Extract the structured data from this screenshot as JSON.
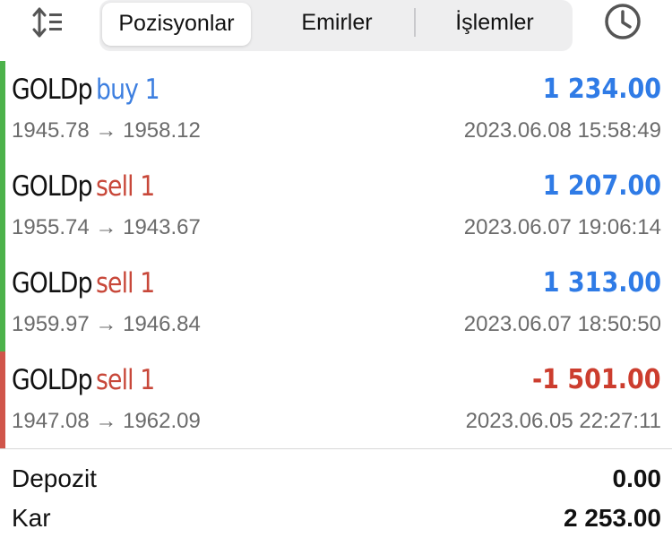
{
  "toolbar": {
    "sort_icon": "sort-icon",
    "history_icon": "clock-icon",
    "tabs": [
      {
        "label": "Pozisyonlar",
        "active": true
      },
      {
        "label": "Emirler",
        "active": false
      },
      {
        "label": "İşlemler",
        "active": false
      }
    ]
  },
  "colors": {
    "buy": "#3d7fe0",
    "sell": "#c8483a",
    "profit_positive": "#2f7be6",
    "profit_negative": "#cc3d2e",
    "bar_green": "#4cb24a",
    "bar_red": "#d0554a"
  },
  "positions": [
    {
      "symbol": "GOLDp",
      "side": "buy 1",
      "type": "buy",
      "profit": "1 234.00",
      "profit_sign": "positive",
      "prices": "1945.78 → 1958.12",
      "time": "2023.06.08 15:58:49"
    },
    {
      "symbol": "GOLDp",
      "side": "sell 1",
      "type": "sell",
      "profit": "1 207.00",
      "profit_sign": "positive",
      "prices": "1955.74 → 1943.67",
      "time": "2023.06.07 19:06:14"
    },
    {
      "symbol": "GOLDp",
      "side": "sell 1",
      "type": "sell",
      "profit": "1 313.00",
      "profit_sign": "positive",
      "prices": "1959.97 → 1946.84",
      "time": "2023.06.07 18:50:50"
    },
    {
      "symbol": "GOLDp",
      "side": "sell 1",
      "type": "sell",
      "profit": "-1 501.00",
      "profit_sign": "negative",
      "prices": "1947.08 → 1962.09",
      "time": "2023.06.05 22:27:11"
    }
  ],
  "summary": {
    "deposit_label": "Depozit",
    "deposit_value": "0.00",
    "profit_label": "Kar",
    "profit_value": "2 253.00"
  }
}
